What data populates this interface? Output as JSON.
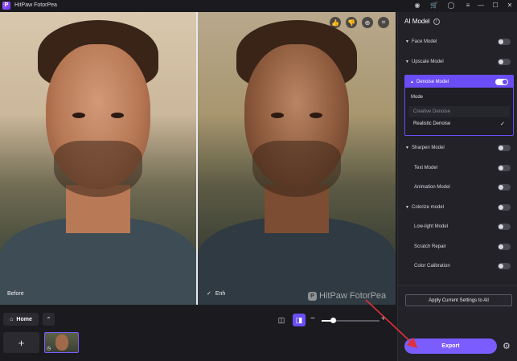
{
  "app": {
    "title": "HitPaw FotorPea",
    "logo_letter": "P"
  },
  "titlebar": {
    "icons": [
      "discord-icon",
      "cart-icon",
      "user-icon",
      "menu-icon"
    ],
    "minimize": "—",
    "maximize": "☐",
    "close": "✕"
  },
  "preview": {
    "before_label": "Before",
    "after_label": "Enh",
    "watermark": "HitPaw FotorPea",
    "view_tools": [
      "thumbs-up-icon",
      "thumbs-down-icon",
      "zoom-icon",
      "crop-icon"
    ]
  },
  "bottom": {
    "home_label": "Home",
    "add_label": "+",
    "zoom_level": 0.2
  },
  "panel": {
    "title": "AI Model",
    "models": [
      {
        "label": "Face Model",
        "on": false,
        "expandable": true
      },
      {
        "label": "Upscale Model",
        "on": false,
        "expandable": true
      }
    ],
    "denoise": {
      "label": "Denoise Model",
      "on": true,
      "mode_label": "Mode",
      "options": [
        "Creative Denoise",
        "Realistic Denoise"
      ],
      "selected": "Realistic Denoise"
    },
    "more_models": [
      {
        "label": "Sharpen Model",
        "on": false,
        "expandable": true
      },
      {
        "label": "Text Model",
        "on": false,
        "expandable": false
      },
      {
        "label": "Animation Model",
        "on": false,
        "expandable": false
      },
      {
        "label": "Colorize model",
        "on": false,
        "expandable": true
      },
      {
        "label": "Low-light Model",
        "on": false,
        "expandable": false
      },
      {
        "label": "Scratch Repair",
        "on": false,
        "expandable": false
      },
      {
        "label": "Color Calibration",
        "on": false,
        "expandable": false
      }
    ],
    "apply_label": "Apply Current Settings to All",
    "export_label": "Export"
  },
  "colors": {
    "accent": "#6a4df5",
    "export": "#7a5cff",
    "annotation": "#e0303a"
  }
}
